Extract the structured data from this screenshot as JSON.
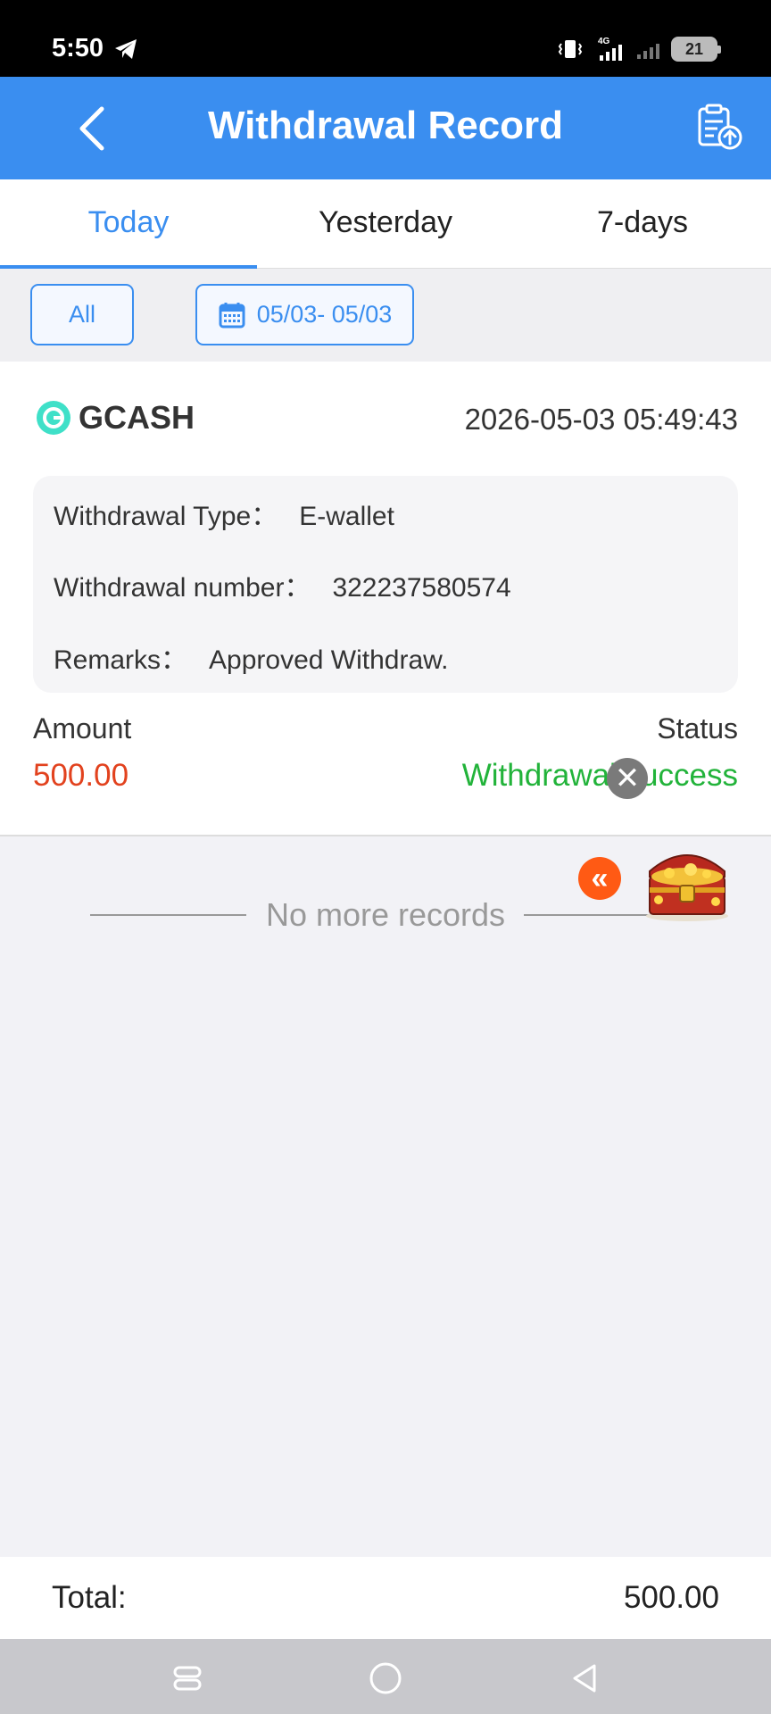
{
  "status_bar": {
    "time": "5:50",
    "network": "4G",
    "battery": "21"
  },
  "header": {
    "title": "Withdrawal Record"
  },
  "tabs": [
    {
      "label": "Today",
      "active": true
    },
    {
      "label": "Yesterday",
      "active": false
    },
    {
      "label": "7-days",
      "active": false
    }
  ],
  "filters": {
    "all_label": "All",
    "date_range": "05/03- 05/03"
  },
  "record": {
    "method": "GCASH",
    "datetime": "2026-05-03 05:49:43",
    "details": [
      {
        "label": "Withdrawal Type：",
        "value": "E-wallet"
      },
      {
        "label": "Withdrawal number：",
        "value": "322237580574"
      },
      {
        "label": "Remarks：",
        "value": "Approved Withdraw."
      }
    ],
    "amount_label": "Amount",
    "amount": "500.00",
    "status_label": "Status",
    "status": "Withdrawal success"
  },
  "list_footer": "No more records",
  "total": {
    "label": "Total:",
    "value": "500.00"
  },
  "colors": {
    "primary": "#3a8ef0",
    "amount": "#e2421e",
    "success": "#22b33a",
    "float_button": "#ff5a14"
  }
}
